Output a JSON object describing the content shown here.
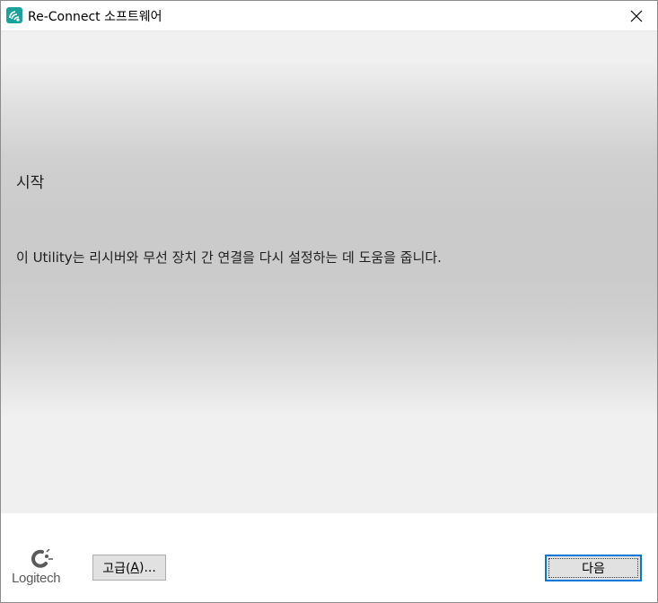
{
  "window": {
    "title": "Re-Connect 소프트웨어",
    "accent_color": "#1aa39a"
  },
  "titlebar": {
    "icon": "reconnect-app-icon",
    "close_icon": "close-icon"
  },
  "content": {
    "heading": "시작",
    "description": "이 Utility는 리시버와 무선 장치 간 연결을 다시 설정하는 데 도움을 줍니다."
  },
  "footer": {
    "logo_text": "Logitech",
    "advanced_button": {
      "prefix": "고급(",
      "mnemonic": "A",
      "suffix": ")..."
    },
    "next_button_label": "다음",
    "focus_color": "#0078d7"
  }
}
